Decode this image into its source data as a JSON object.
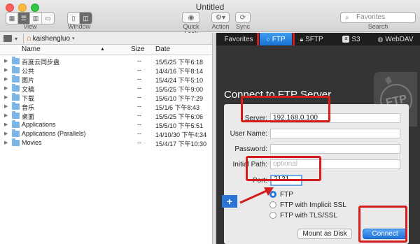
{
  "window": {
    "title": "Untitled"
  },
  "toolbar": {
    "view_label": "View",
    "window_label": "Window",
    "quicklook_label": "Quick Look",
    "action_label": "Action",
    "sync_label": "Sync",
    "search_placeholder": "Favorites",
    "search_label": "Search"
  },
  "left": {
    "username": "kaishengluo",
    "columns": {
      "name": "Name",
      "size": "Size",
      "date": "Date"
    },
    "files": [
      {
        "name": "百度云同步盘",
        "size": "--",
        "date": "15/5/25 下午6:18"
      },
      {
        "name": "公共",
        "size": "--",
        "date": "14/4/16 下午8:14"
      },
      {
        "name": "图片",
        "size": "--",
        "date": "15/4/24 下午5:10"
      },
      {
        "name": "文稿",
        "size": "--",
        "date": "15/5/25 下午9:00"
      },
      {
        "name": "下载",
        "size": "--",
        "date": "15/6/10 下午7:29"
      },
      {
        "name": "音乐",
        "size": "--",
        "date": "15/1/6 下午8:43"
      },
      {
        "name": "桌面",
        "size": "--",
        "date": "15/5/25 下午6:06"
      },
      {
        "name": "Applications",
        "size": "--",
        "date": "15/5/10 下午5:51"
      },
      {
        "name": "Applications (Parallels)",
        "size": "--",
        "date": "14/10/30 下午4:34"
      },
      {
        "name": "Movies",
        "size": "--",
        "date": "15/4/17 下午10:30"
      }
    ]
  },
  "right": {
    "tabs": [
      {
        "label": "Favorites",
        "icon": "favorites"
      },
      {
        "label": "FTP",
        "icon": "ftp-ring"
      },
      {
        "label": "SFTP",
        "icon": "lock"
      },
      {
        "label": "S3",
        "icon": "s3"
      },
      {
        "label": "WebDAV",
        "icon": "globe"
      }
    ],
    "selected_tab": "FTP",
    "heading": "Connect to FTP Server",
    "badge_text": "FTP",
    "form": {
      "server_label": "Server:",
      "server_value": "192.168.0.100",
      "username_label": "User Name:",
      "username_value": "",
      "password_label": "Password:",
      "password_value": "",
      "initial_path_label": "Initial Path:",
      "initial_path_placeholder": "optional",
      "port_label": "Port:",
      "port_value": "2121",
      "protocols": [
        "FTP",
        "FTP with Implicit SSL",
        "FTP with TLS/SSL"
      ],
      "selected_protocol": "FTP",
      "mount_button": "Mount as Disk",
      "connect_button": "Connect"
    },
    "accent_color": "#2a78d8",
    "annotation_color": "#d31d1d"
  }
}
